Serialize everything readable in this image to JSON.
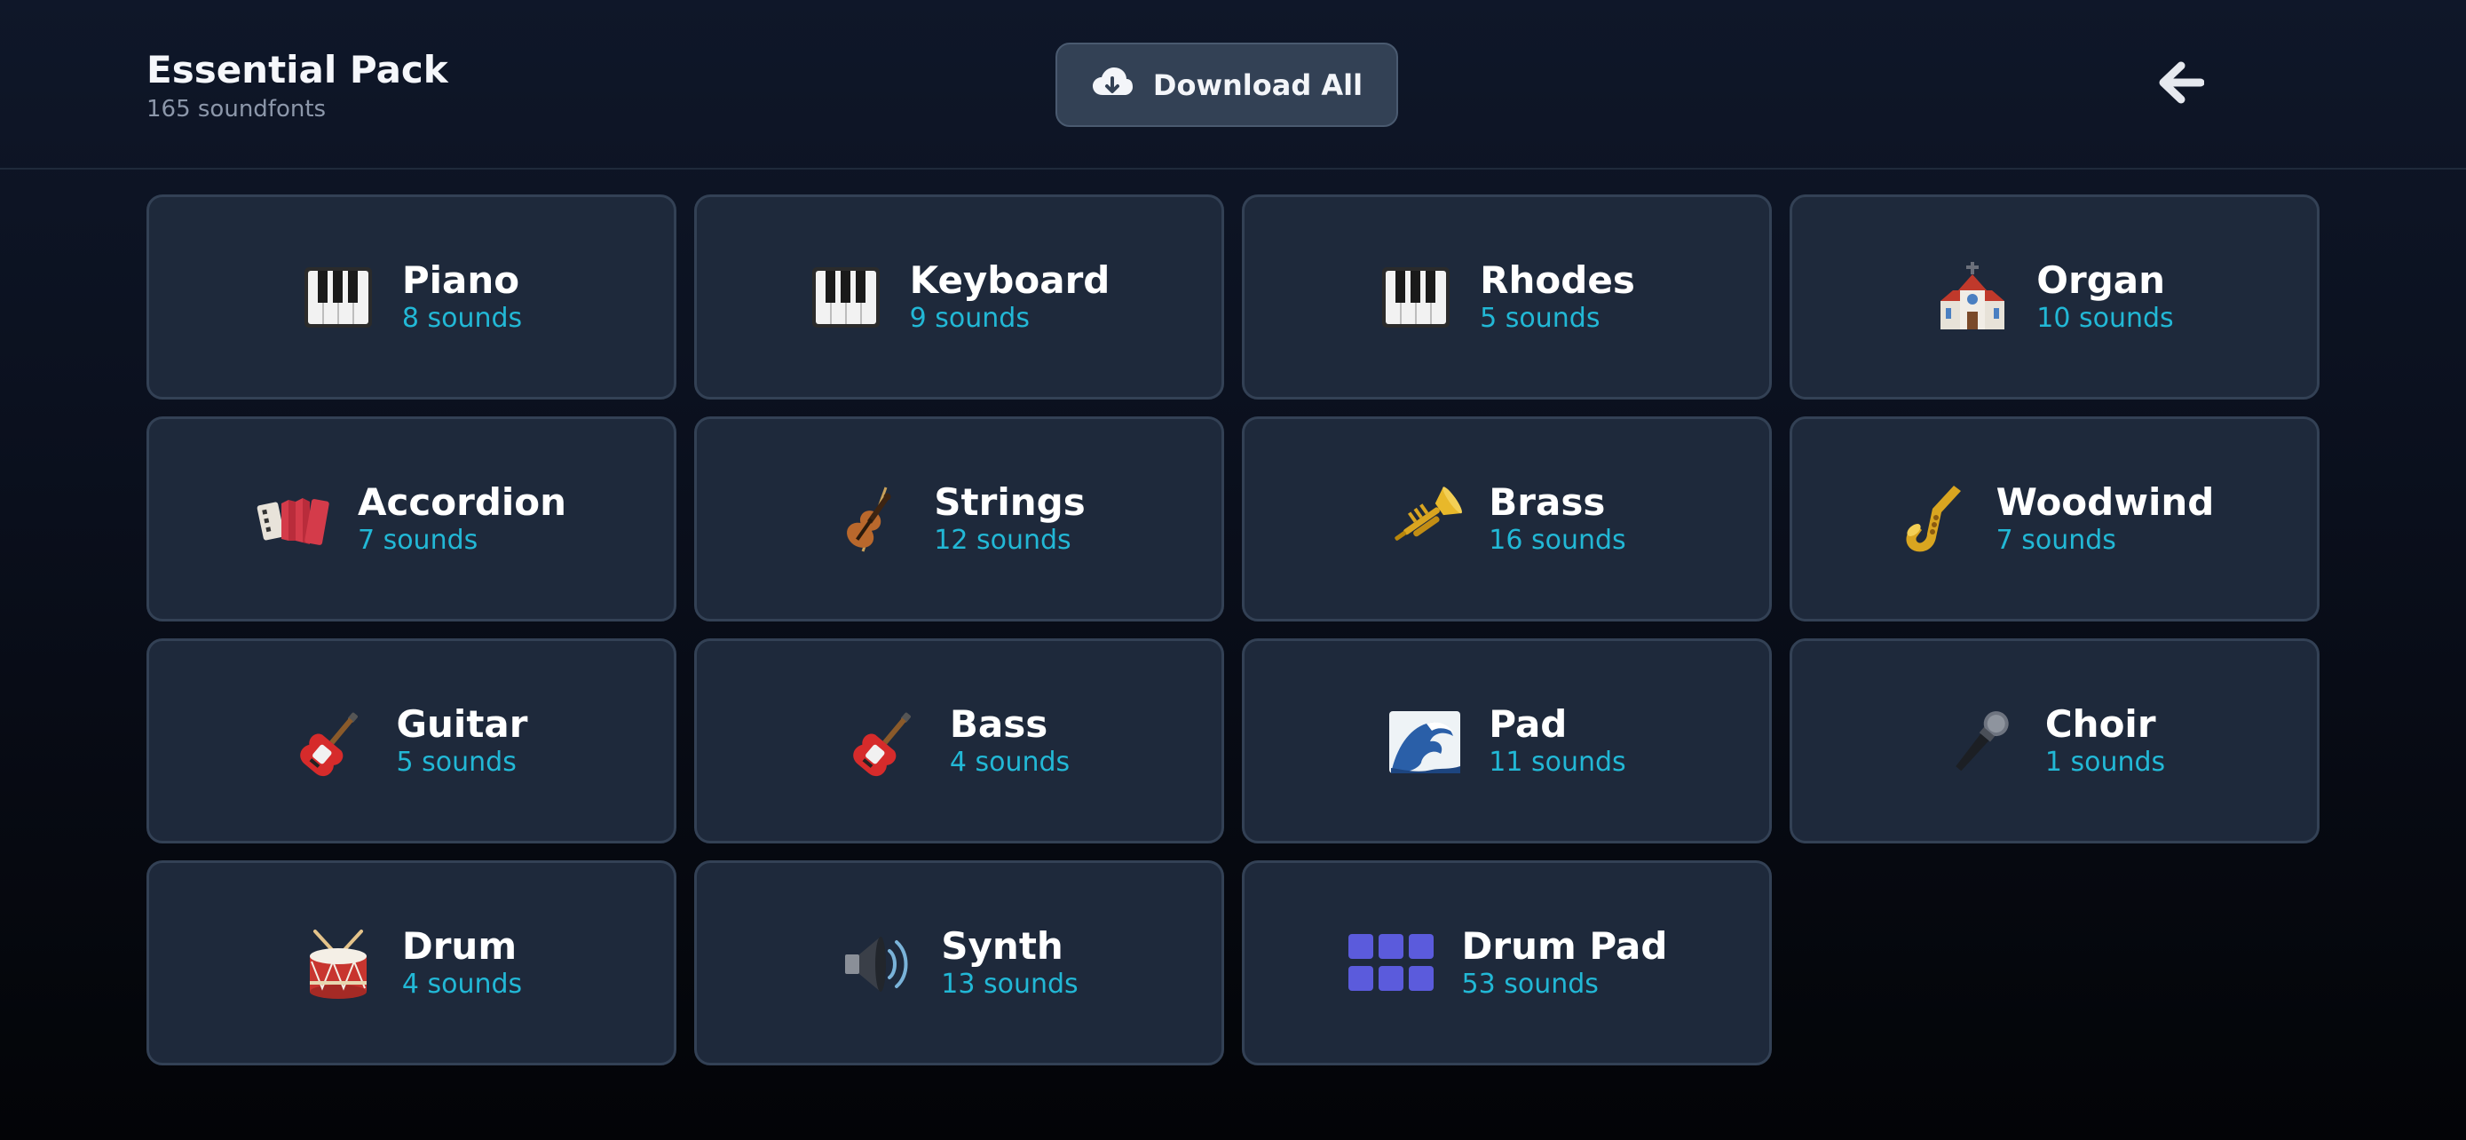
{
  "header": {
    "title": "Essential Pack",
    "subtitle": "165 soundfonts",
    "download_label": "Download All"
  },
  "colors": {
    "background": "#0f1729",
    "card": "#1e293b",
    "card_border": "#334155",
    "accent": "#22b8d6",
    "button": "#334155"
  },
  "categories": [
    {
      "name": "Piano",
      "count": "8 sounds",
      "icon": "piano-keys-icon"
    },
    {
      "name": "Keyboard",
      "count": "9 sounds",
      "icon": "piano-keys-icon"
    },
    {
      "name": "Rhodes",
      "count": "5 sounds",
      "icon": "piano-keys-icon"
    },
    {
      "name": "Organ",
      "count": "10 sounds",
      "icon": "church-icon"
    },
    {
      "name": "Accordion",
      "count": "7 sounds",
      "icon": "accordion-icon"
    },
    {
      "name": "Strings",
      "count": "12 sounds",
      "icon": "violin-icon"
    },
    {
      "name": "Brass",
      "count": "16 sounds",
      "icon": "trumpet-icon"
    },
    {
      "name": "Woodwind",
      "count": "7 sounds",
      "icon": "saxophone-icon"
    },
    {
      "name": "Guitar",
      "count": "5 sounds",
      "icon": "guitar-icon"
    },
    {
      "name": "Bass",
      "count": "4 sounds",
      "icon": "guitar-icon"
    },
    {
      "name": "Pad",
      "count": "11 sounds",
      "icon": "wave-icon"
    },
    {
      "name": "Choir",
      "count": "1 sounds",
      "icon": "microphone-icon"
    },
    {
      "name": "Drum",
      "count": "4 sounds",
      "icon": "drum-icon"
    },
    {
      "name": "Synth",
      "count": "13 sounds",
      "icon": "speaker-icon"
    },
    {
      "name": "Drum Pad",
      "count": "53 sounds",
      "icon": "drum-pad-grid-icon"
    }
  ]
}
